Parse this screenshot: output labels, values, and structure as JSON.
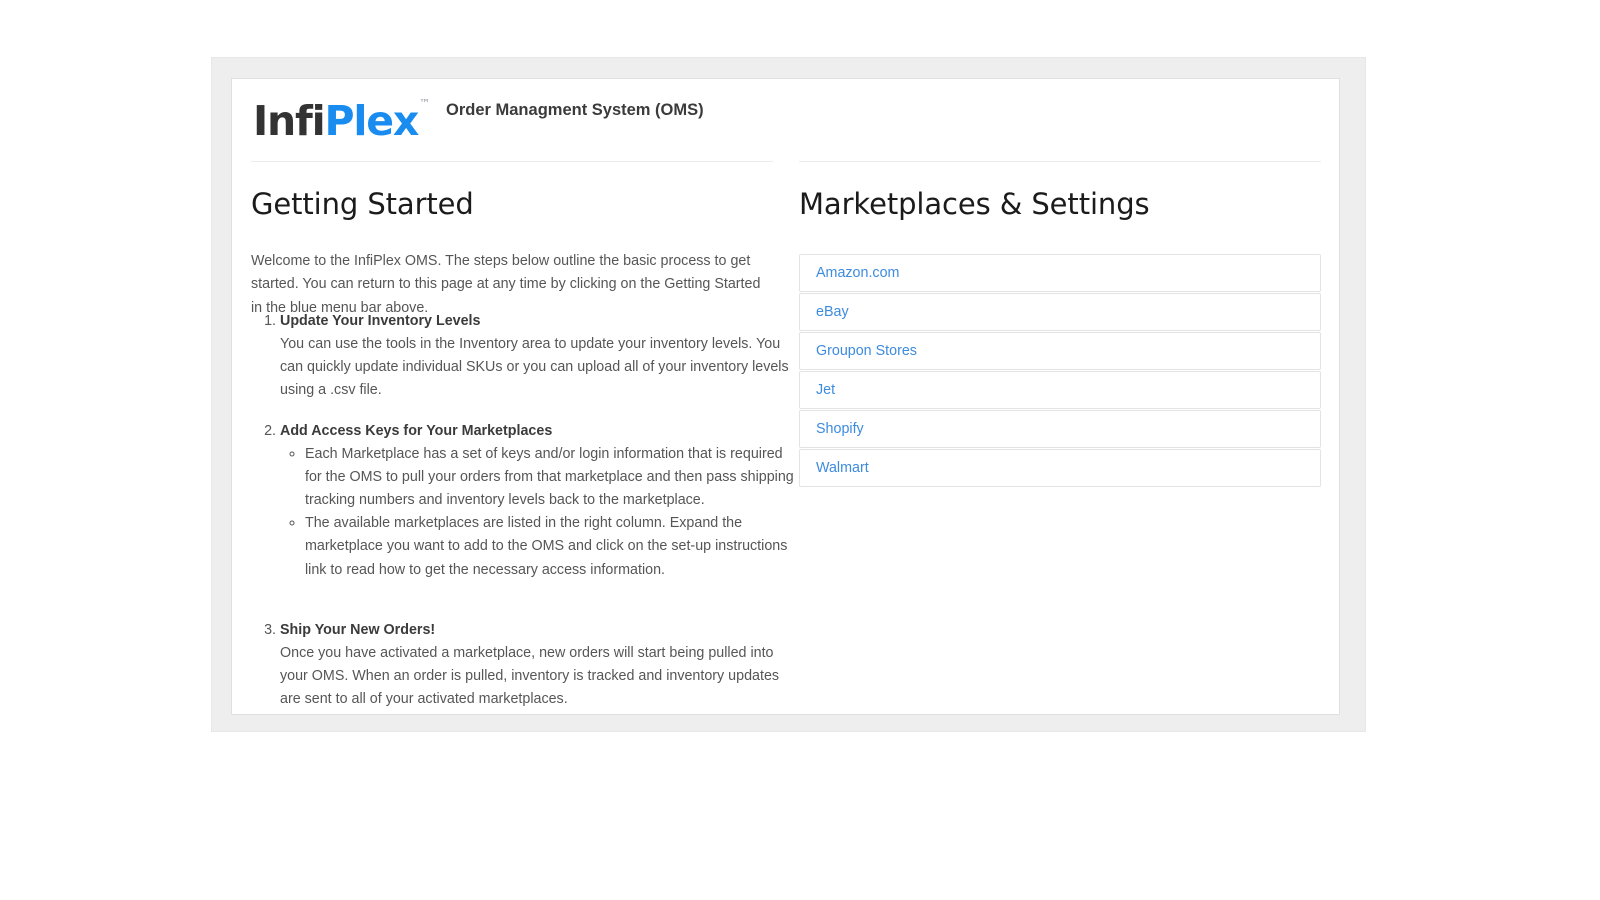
{
  "header": {
    "logo_primary": "Infi",
    "logo_accent": "Plex",
    "logo_trademark": "™",
    "app_title": "Order Managment System (OMS)"
  },
  "left_column": {
    "heading": "Getting Started",
    "intro": "Welcome to the InfiPlex OMS. The steps below outline the basic process to get started. You can return to this page at any time by clicking on the Getting Started in the blue menu bar above.",
    "steps": [
      {
        "number": "1.",
        "title": "Update Your Inventory Levels",
        "body": "You can use the tools in the Inventory area to update your inventory levels. You can quickly update individual SKUs or you can upload all of your inventory levels using a .csv file.",
        "sub_items": []
      },
      {
        "number": "2.",
        "title": "Add Access Keys for Your Marketplaces",
        "body": "",
        "sub_items": [
          "Each Marketplace has a set of keys and/or login information that is required for the OMS to pull your orders from that marketplace and then pass shipping tracking numbers and inventory levels back to the marketplace.",
          "The available marketplaces are listed in the right column. Expand the marketplace you want to add to the OMS and click on the set-up instructions link to read how to get the necessary access information."
        ]
      },
      {
        "number": "3.",
        "title": "Ship Your New Orders!",
        "body": "Once you have activated a marketplace, new orders will start being pulled into your OMS. When an order is pulled, inventory is tracked and inventory updates are sent to all of your activated marketplaces.",
        "sub_items": []
      }
    ]
  },
  "right_column": {
    "heading": "Marketplaces & Settings",
    "marketplaces": [
      {
        "label": "Amazon.com"
      },
      {
        "label": "eBay"
      },
      {
        "label": "Groupon Stores"
      },
      {
        "label": "Jet"
      },
      {
        "label": "Shopify"
      },
      {
        "label": "Walmart"
      }
    ]
  },
  "colors": {
    "link_blue": "#3d8bdf",
    "logo_blue": "#1a8cf0",
    "heading_dark": "#1b1b1b",
    "body_gray": "#565656",
    "wrapper_gray": "#eeeeee"
  }
}
